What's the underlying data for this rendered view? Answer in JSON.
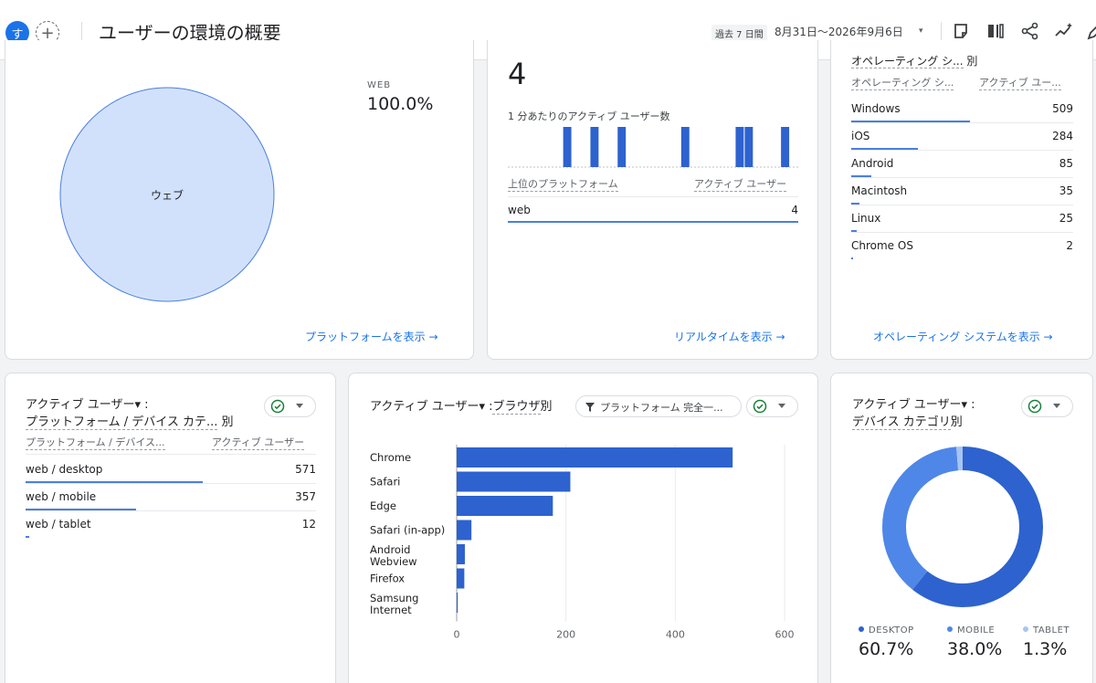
{
  "header": {
    "avatar_letter": "す",
    "add_symbol": "+",
    "title": "ユーザーの環境の概要",
    "date_chip": "過去 7 日間",
    "date_range": "8月31日～2026年9月6日",
    "date_dropdown": "▾"
  },
  "platform_card": {
    "legend_label": "WEB",
    "legend_value": "100.0%",
    "pie_label": "ウェブ",
    "link": "プラットフォームを表示 →"
  },
  "realtime_card": {
    "value": "4",
    "subtitle": "1 分あたりのアクティブ ユーザー数",
    "col1": "上位のプラットフォーム",
    "col2": "アクティブ ユーザー",
    "row_label": "web",
    "row_value": "4",
    "link": "リアルタイムを表示 →"
  },
  "os_card": {
    "title_partial": "オペレーティング シ...",
    "title_suffix": "別",
    "col1": "オペレーティング シ...",
    "col2": "アクティブ ユー...",
    "rows": [
      {
        "label": "Windows",
        "value": "509"
      },
      {
        "label": "iOS",
        "value": "284"
      },
      {
        "label": "Android",
        "value": "85"
      },
      {
        "label": "Macintosh",
        "value": "35"
      },
      {
        "label": "Linux",
        "value": "25"
      },
      {
        "label": "Chrome OS",
        "value": "2"
      }
    ],
    "link": "オペレーティング システムを表示 →"
  },
  "device_platform_card": {
    "title_line1": "アクティブ ユーザー▾ :",
    "title_line2": "プラットフォーム / デバイス カテ...",
    "title_suffix": "別",
    "col1": "プラットフォーム / デバイス...",
    "col2": "アクティブ ユーザー",
    "rows": [
      {
        "label": "web / desktop",
        "value": "571"
      },
      {
        "label": "web / mobile",
        "value": "357"
      },
      {
        "label": "web / tablet",
        "value": "12"
      }
    ]
  },
  "browser_card": {
    "title_prefix": "アクティブ ユーザー▾ :",
    "title_dim": "ブラウザ",
    "title_suffix": "別",
    "filter_label": "プラットフォーム 完全一..."
  },
  "device_card": {
    "title_line1": "アクティブ ユーザー▾ :",
    "title_line2": "デバイス カテゴリ",
    "title_suffix": "別",
    "legend": [
      {
        "label": "DESKTOP",
        "value": "60.7%",
        "color": "#2d62cf"
      },
      {
        "label": "MOBILE",
        "value": "38.0%",
        "color": "#4f87e8"
      },
      {
        "label": "TABLET",
        "value": "1.3%",
        "color": "#a8c4f5"
      }
    ]
  },
  "chart_data": [
    {
      "type": "pie",
      "categories": [
        "ウェブ"
      ],
      "values": [
        100.0
      ],
      "legend": "top-right",
      "colors": [
        "#d2e1fb"
      ]
    },
    {
      "type": "bar",
      "title": "1 分あたりのアクティブ ユーザー数",
      "values": [
        0,
        0,
        0,
        0,
        0,
        0,
        1,
        0,
        0,
        1,
        0,
        0,
        1,
        0,
        0,
        0,
        0,
        0,
        0,
        1,
        0,
        0,
        0,
        0,
        0,
        1,
        1,
        0,
        0,
        0,
        1,
        0
      ],
      "color": "#2d62cf"
    },
    {
      "type": "bar",
      "orientation": "horizontal",
      "categories": [
        "Chrome",
        "Safari",
        "Edge",
        "Safari (in-app)",
        "Android Webview",
        "Firefox",
        "Samsung Internet"
      ],
      "values": [
        505,
        208,
        176,
        27,
        15,
        14,
        2
      ],
      "xticks": [
        "0",
        "200",
        "400",
        "600"
      ],
      "xlim": [
        0,
        600
      ],
      "grid": true,
      "color": "#2d62cf"
    },
    {
      "type": "pie",
      "style": "donut",
      "categories": [
        "DESKTOP",
        "MOBILE",
        "TABLET"
      ],
      "values": [
        60.7,
        38.0,
        1.3
      ],
      "legend": "bottom",
      "colors": [
        "#2d62cf",
        "#4f87e8",
        "#a8c4f5"
      ]
    }
  ]
}
